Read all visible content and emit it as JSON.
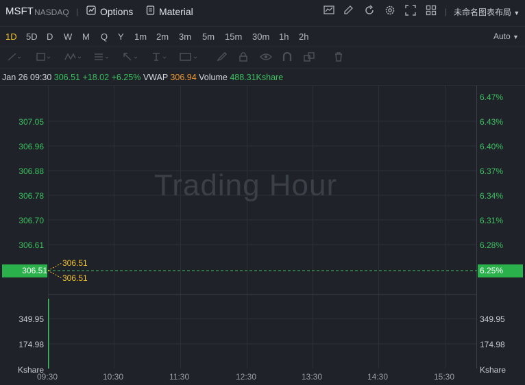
{
  "header": {
    "symbol": "MSFT",
    "exchange": "NASDAQ",
    "separator": "|",
    "options_label": "Options",
    "material_label": "Material",
    "layout_label": "未命名图表布局",
    "icons": [
      "chart-add-icon",
      "edit-icon",
      "refresh-icon",
      "settings-icon",
      "fullscreen-icon",
      "grid-icon"
    ]
  },
  "timeframes": [
    "1D",
    "5D",
    "D",
    "W",
    "M",
    "Q",
    "Y",
    "1m",
    "2m",
    "3m",
    "5m",
    "15m",
    "30m",
    "1h",
    "2h"
  ],
  "active_timeframe": "1D",
  "auto_label": "Auto",
  "quote": {
    "datetime": "Jan 26 09:30",
    "price": "306.51",
    "change": "+18.02",
    "change_pct": "+6.25%",
    "vwap_label": "VWAP",
    "vwap": "306.94",
    "volume_label": "Volume",
    "volume": "488.31Kshare"
  },
  "watermark": "Trading Hour",
  "price_axis": [
    "307.05",
    "306.96",
    "306.88",
    "306.78",
    "306.70",
    "306.61"
  ],
  "pct_axis": [
    "6.47%",
    "6.43%",
    "6.40%",
    "6.37%",
    "6.34%",
    "6.31%",
    "6.28%"
  ],
  "current": {
    "price": "306.51",
    "pct": "6.25%"
  },
  "annotations": [
    "306.51",
    "306.51"
  ],
  "volume_axis": [
    "349.95",
    "174.98",
    "Kshare"
  ],
  "time_axis": [
    "09:30",
    "10:30",
    "11:30",
    "12:30",
    "13:30",
    "14:30",
    "15:30"
  ],
  "colors": {
    "up": "#3cc15f",
    "vwap": "#f29a2e",
    "active": "#f2c230",
    "background": "#1f2229"
  }
}
